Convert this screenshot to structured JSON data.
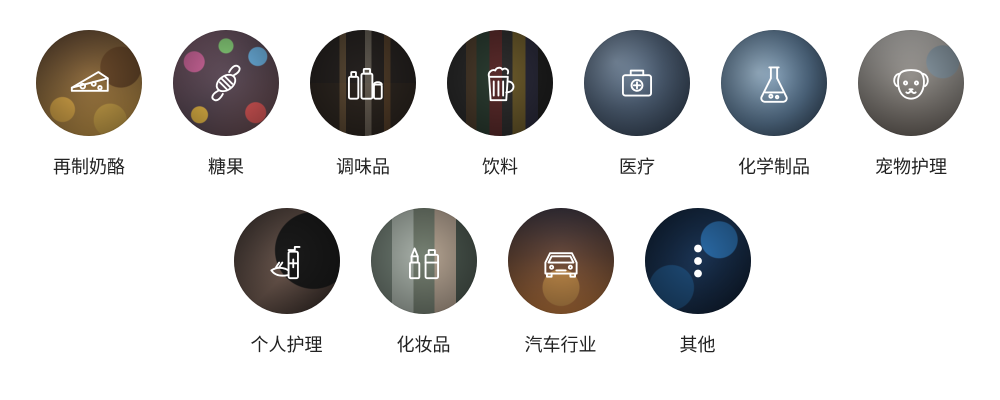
{
  "categories": [
    {
      "label": "再制奶酪",
      "icon": "cheese-icon"
    },
    {
      "label": "糖果",
      "icon": "candy-icon"
    },
    {
      "label": "调味品",
      "icon": "condiments-bottles-icon"
    },
    {
      "label": "饮料",
      "icon": "beverage-mug-icon"
    },
    {
      "label": "医疗",
      "icon": "medical-kit-icon"
    },
    {
      "label": "化学制品",
      "icon": "flask-icon"
    },
    {
      "label": "宠物护理",
      "icon": "dog-face-icon"
    },
    {
      "label": "个人护理",
      "icon": "hand-sanitizer-icon"
    },
    {
      "label": "化妆品",
      "icon": "lipstick-bottle-icon"
    },
    {
      "label": "汽车行业",
      "icon": "car-icon"
    },
    {
      "label": "其他",
      "icon": "more-dots-icon"
    }
  ]
}
